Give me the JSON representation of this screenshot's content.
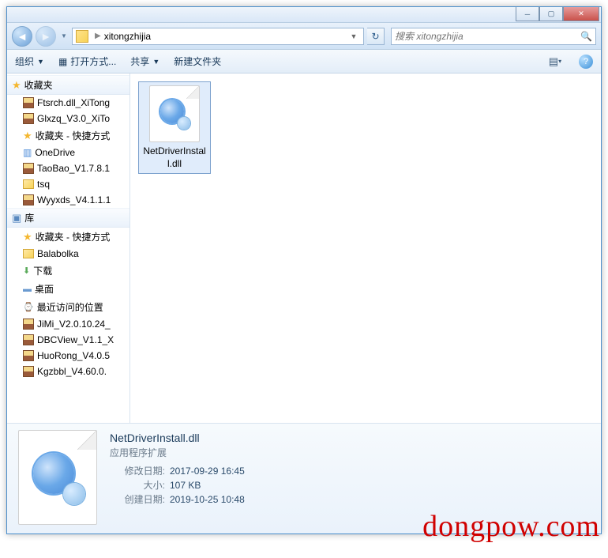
{
  "titlebar": {
    "min": "─",
    "max": "▢",
    "close": "✕"
  },
  "nav": {
    "back": "◄",
    "forward": "►",
    "path_segment": "xitongzhijia",
    "refresh": "↻",
    "search_placeholder": "搜索 xitongzhijia",
    "search_icon": "🔍"
  },
  "toolbar": {
    "organize": "组织",
    "open_with": "打开方式...",
    "share": "共享",
    "new_folder": "新建文件夹",
    "view_drop": "▾",
    "help": "?"
  },
  "sidebar": {
    "favorites_header": "收藏夹",
    "libraries_header": "库",
    "items_fav": [
      {
        "icon": "rar",
        "label": "Ftsrch.dll_XiTong"
      },
      {
        "icon": "rar",
        "label": "Glxzq_V3.0_XiTo"
      },
      {
        "icon": "star",
        "label": "收藏夹 - 快捷方式"
      },
      {
        "icon": "cloud",
        "label": "OneDrive"
      },
      {
        "icon": "rar",
        "label": "TaoBao_V1.7.8.1"
      },
      {
        "icon": "folder",
        "label": "tsq"
      },
      {
        "icon": "rar",
        "label": "Wyyxds_V4.1.1.1"
      }
    ],
    "items_lib": [
      {
        "icon": "star",
        "label": "收藏夹 - 快捷方式"
      },
      {
        "icon": "folder",
        "label": "Balabolka"
      },
      {
        "icon": "dl",
        "label": "下载"
      },
      {
        "icon": "desk",
        "label": "桌面"
      },
      {
        "icon": "recent",
        "label": "最近访问的位置"
      },
      {
        "icon": "rar",
        "label": "JiMi_V2.0.10.24_"
      },
      {
        "icon": "rar",
        "label": "DBCView_V1.1_X"
      },
      {
        "icon": "rar",
        "label": "HuoRong_V4.0.5"
      },
      {
        "icon": "rar",
        "label": "Kgzbbl_V4.60.0."
      }
    ]
  },
  "content": {
    "file_name": "NetDriverInstall.dll"
  },
  "details": {
    "filename": "NetDriverInstall.dll",
    "filetype": "应用程序扩展",
    "rows": [
      {
        "label": "修改日期:",
        "value": "2017-09-29 16:45"
      },
      {
        "label": "大小:",
        "value": "107 KB"
      },
      {
        "label": "创建日期:",
        "value": "2019-10-25 10:48"
      }
    ]
  },
  "watermark": "dongpow.com"
}
